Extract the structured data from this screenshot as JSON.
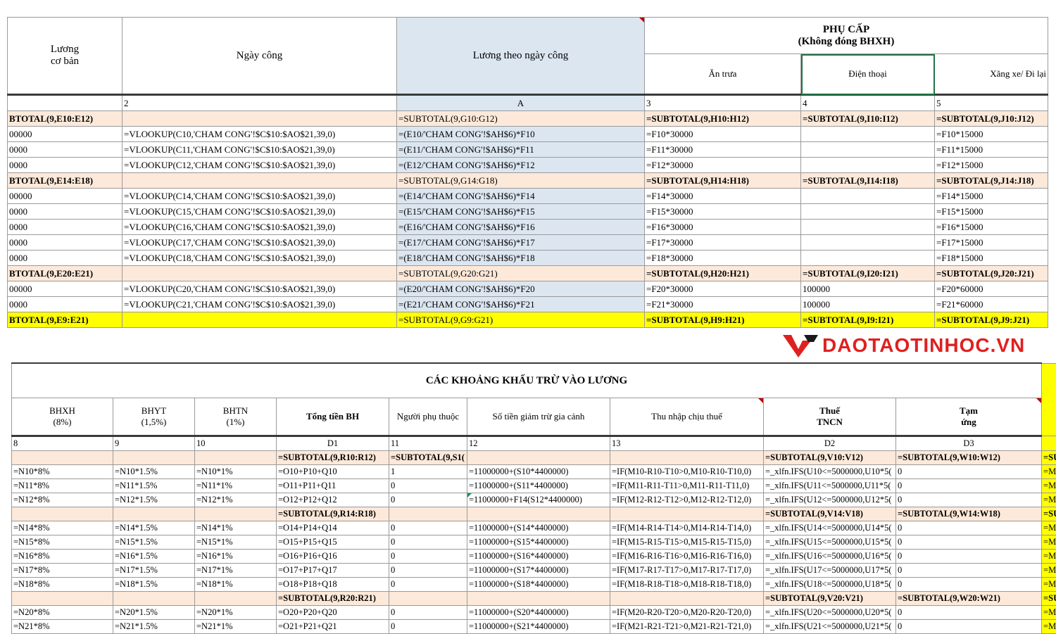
{
  "top": {
    "headers": {
      "luong_co_ban": "Lương\ncơ bản",
      "ngay_cong": "Ngày công",
      "luong_theo_ngay_cong": "Lương theo ngày công",
      "phu_cap": "PHỤ CẤP",
      "phu_cap_sub": "(Không đóng BHXH)",
      "an_trua": "Ăn trưa",
      "dien_thoai": "Điện thoại",
      "xang_xe": "Xăng xe/ Đi lại"
    },
    "index_row": [
      "",
      "2",
      "A",
      "3",
      "4",
      "5"
    ],
    "rows": [
      {
        "type": "sub",
        "cells": [
          "BTOTAL(9,E10:E12)",
          "",
          "=SUBTOTAL(9,G10:G12)",
          "=SUBTOTAL(9,H10:H12)",
          "=SUBTOTAL(9,I10:I12)",
          "=SUBTOTAL(9,J10:J12)"
        ]
      },
      {
        "type": "row",
        "cells": [
          "00000",
          "=VLOOKUP(C10,'CHAM CONG'!$C$10:$AO$21,39,0)",
          "=(E10/'CHAM CONG'!$AH$6)*F10",
          "=F10*30000",
          "",
          "=F10*15000"
        ]
      },
      {
        "type": "row",
        "cells": [
          "0000",
          "=VLOOKUP(C11,'CHAM CONG'!$C$10:$AO$21,39,0)",
          "=(E11/'CHAM CONG'!$AH$6)*F11",
          "=F11*30000",
          "",
          "=F11*15000"
        ]
      },
      {
        "type": "row",
        "cells": [
          "0000",
          "=VLOOKUP(C12,'CHAM CONG'!$C$10:$AO$21,39,0)",
          "=(E12/'CHAM CONG'!$AH$6)*F12",
          "=F12*30000",
          "",
          "=F12*15000"
        ]
      },
      {
        "type": "sub",
        "cells": [
          "BTOTAL(9,E14:E18)",
          "",
          "=SUBTOTAL(9,G14:G18)",
          "=SUBTOTAL(9,H14:H18)",
          "=SUBTOTAL(9,I14:I18)",
          "=SUBTOTAL(9,J14:J18)"
        ]
      },
      {
        "type": "row",
        "cells": [
          "00000",
          "=VLOOKUP(C14,'CHAM CONG'!$C$10:$AO$21,39,0)",
          "=(E14/'CHAM CONG'!$AH$6)*F14",
          "=F14*30000",
          "",
          "=F14*15000"
        ]
      },
      {
        "type": "row",
        "cells": [
          "0000",
          "=VLOOKUP(C15,'CHAM CONG'!$C$10:$AO$21,39,0)",
          "=(E15/'CHAM CONG'!$AH$6)*F15",
          "=F15*30000",
          "",
          "=F15*15000"
        ]
      },
      {
        "type": "row",
        "cells": [
          "0000",
          "=VLOOKUP(C16,'CHAM CONG'!$C$10:$AO$21,39,0)",
          "=(E16/'CHAM CONG'!$AH$6)*F16",
          "=F16*30000",
          "",
          "=F16*15000"
        ]
      },
      {
        "type": "row",
        "cells": [
          "0000",
          "=VLOOKUP(C17,'CHAM CONG'!$C$10:$AO$21,39,0)",
          "=(E17/'CHAM CONG'!$AH$6)*F17",
          "=F17*30000",
          "",
          "=F17*15000"
        ]
      },
      {
        "type": "row",
        "cells": [
          "0000",
          "=VLOOKUP(C18,'CHAM CONG'!$C$10:$AO$21,39,0)",
          "=(E18/'CHAM CONG'!$AH$6)*F18",
          "=F18*30000",
          "",
          "=F18*15000"
        ]
      },
      {
        "type": "sub",
        "cells": [
          "BTOTAL(9,E20:E21)",
          "",
          "=SUBTOTAL(9,G20:G21)",
          "=SUBTOTAL(9,H20:H21)",
          "=SUBTOTAL(9,I20:I21)",
          "=SUBTOTAL(9,J20:J21)"
        ]
      },
      {
        "type": "row",
        "cells": [
          "00000",
          "=VLOOKUP(C20,'CHAM CONG'!$C$10:$AO$21,39,0)",
          "=(E20/'CHAM CONG'!$AH$6)*F20",
          "=F20*30000",
          "100000",
          "=F20*60000"
        ]
      },
      {
        "type": "row",
        "cells": [
          "0000",
          "=VLOOKUP(C21,'CHAM CONG'!$C$10:$AO$21,39,0)",
          "=(E21/'CHAM CONG'!$AH$6)*F21",
          "=F21*30000",
          "100000",
          "=F21*60000"
        ]
      },
      {
        "type": "total",
        "cells": [
          "BTOTAL(9,E9:E21)",
          "",
          "=SUBTOTAL(9,G9:G21)",
          "=SUBTOTAL(9,H9:H21)",
          "=SUBTOTAL(9,I9:I21)",
          "=SUBTOTAL(9,J9:J21)"
        ]
      }
    ]
  },
  "logo": {
    "text": "DAOTAOTINHOC.VN",
    "color": "#e02020"
  },
  "bottom": {
    "title": "CÁC KHOẢNG KHẤU TRỪ VÀO LƯƠNG",
    "headers": [
      "BHXH\n(8%)",
      "BHYT\n(1,5%)",
      "BHTN\n(1%)",
      "Tổng tiền BH",
      "Người phụ thuộc",
      "Số tiền giảm trừ gia cảnh",
      "Thu nhập chịu thuế",
      "Thuế\nTNCN",
      "Tạm\nứng"
    ],
    "index_row": [
      "8",
      "9",
      "10",
      "D1",
      "11",
      "12",
      "13",
      "D2",
      "D3"
    ],
    "rows": [
      {
        "type": "sub",
        "cells": [
          "",
          "",
          "",
          "=SUBTOTAL(9,R10:R12)",
          "=SUBTOTAL(9,S1(",
          "",
          "",
          "=SUBTOTAL(9,V10:V12)",
          "=SUBTOTAL(9,W10:W12)",
          "=SU"
        ]
      },
      {
        "type": "row",
        "cells": [
          "=N10*8%",
          "=N10*1.5%",
          "=N10*1%",
          "=O10+P10+Q10",
          "1",
          "=11000000+(S10*4400000)",
          "=IF(M10-R10-T10>0,M10-R10-T10,0)",
          "=_xlfn.IFS(U10<=5000000,U10*5(",
          "0",
          "=M"
        ]
      },
      {
        "type": "row",
        "cells": [
          "=N11*8%",
          "=N11*1.5%",
          "=N11*1%",
          "=O11+P11+Q11",
          "0",
          "=11000000+(S11*4400000)",
          "=IF(M11-R11-T11>0,M11-R11-T11,0)",
          "=_xlfn.IFS(U11<=5000000,U11*5(",
          "0",
          "=M"
        ]
      },
      {
        "type": "row",
        "cells": [
          "=N12*8%",
          "=N12*1.5%",
          "=N12*1%",
          "=O12+P12+Q12",
          "0",
          "=11000000+F14(S12*4400000)",
          "=IF(M12-R12-T12>0,M12-R12-T12,0)",
          "=_xlfn.IFS(U12<=5000000,U12*5(",
          "0",
          "=M"
        ]
      },
      {
        "type": "sub",
        "cells": [
          "",
          "",
          "",
          "=SUBTOTAL(9,R14:R18)",
          "",
          "",
          "",
          "=SUBTOTAL(9,V14:V18)",
          "=SUBTOTAL(9,W14:W18)",
          "=SU"
        ]
      },
      {
        "type": "row",
        "cells": [
          "=N14*8%",
          "=N14*1.5%",
          "=N14*1%",
          "=O14+P14+Q14",
          "0",
          "=11000000+(S14*4400000)",
          "=IF(M14-R14-T14>0,M14-R14-T14,0)",
          "=_xlfn.IFS(U14<=5000000,U14*5(",
          "0",
          "=M"
        ]
      },
      {
        "type": "row",
        "cells": [
          "=N15*8%",
          "=N15*1.5%",
          "=N15*1%",
          "=O15+P15+Q15",
          "0",
          "=11000000+(S15*4400000)",
          "=IF(M15-R15-T15>0,M15-R15-T15,0)",
          "=_xlfn.IFS(U15<=5000000,U15*5(",
          "0",
          "=M"
        ]
      },
      {
        "type": "row",
        "cells": [
          "=N16*8%",
          "=N16*1.5%",
          "=N16*1%",
          "=O16+P16+Q16",
          "0",
          "=11000000+(S16*4400000)",
          "=IF(M16-R16-T16>0,M16-R16-T16,0)",
          "=_xlfn.IFS(U16<=5000000,U16*5(",
          "0",
          "=M"
        ]
      },
      {
        "type": "row",
        "cells": [
          "=N17*8%",
          "=N17*1.5%",
          "=N17*1%",
          "=O17+P17+Q17",
          "0",
          "=11000000+(S17*4400000)",
          "=IF(M17-R17-T17>0,M17-R17-T17,0)",
          "=_xlfn.IFS(U17<=5000000,U17*5(",
          "0",
          "=M"
        ]
      },
      {
        "type": "row",
        "cells": [
          "=N18*8%",
          "=N18*1.5%",
          "=N18*1%",
          "=O18+P18+Q18",
          "0",
          "=11000000+(S18*4400000)",
          "=IF(M18-R18-T18>0,M18-R18-T18,0)",
          "=_xlfn.IFS(U18<=5000000,U18*5(",
          "0",
          "=M"
        ]
      },
      {
        "type": "sub",
        "cells": [
          "",
          "",
          "",
          "=SUBTOTAL(9,R20:R21)",
          "",
          "",
          "",
          "=SUBTOTAL(9,V20:V21)",
          "=SUBTOTAL(9,W20:W21)",
          "=SU"
        ]
      },
      {
        "type": "row",
        "cells": [
          "=N20*8%",
          "=N20*1.5%",
          "=N20*1%",
          "=O20+P20+Q20",
          "0",
          "=11000000+(S20*4400000)",
          "=IF(M20-R20-T20>0,M20-R20-T20,0)",
          "=_xlfn.IFS(U20<=5000000,U20*5(",
          "0",
          "=M"
        ]
      },
      {
        "type": "row",
        "cells": [
          "=N21*8%",
          "=N21*1.5%",
          "=N21*1%",
          "=O21+P21+Q21",
          "0",
          "=11000000+(S21*4400000)",
          "=IF(M21-R21-T21>0,M21-R21-T21,0)",
          "=_xlfn.IFS(U21<=5000000,U21*5(",
          "0",
          "=M"
        ]
      }
    ]
  }
}
